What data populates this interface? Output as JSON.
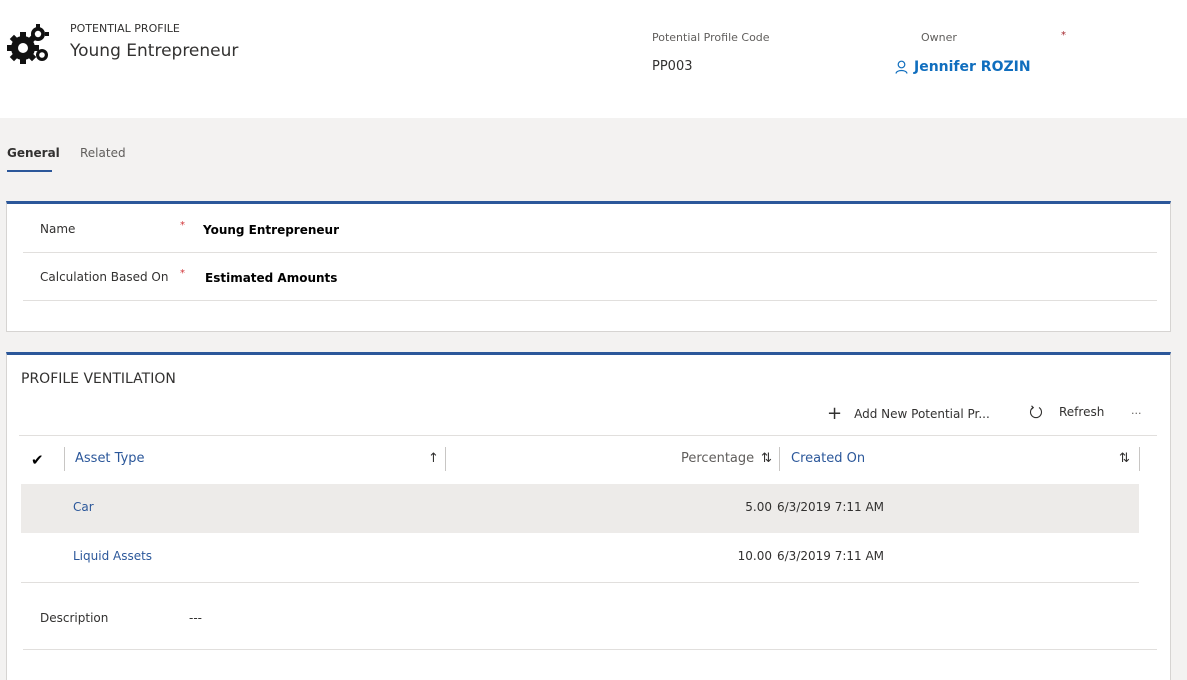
{
  "header": {
    "entity_type": "POTENTIAL PROFILE",
    "record_name": "Young Entrepreneur",
    "code_label": "Potential Profile Code",
    "code_value": "PP003",
    "owner_label": "Owner",
    "owner_required": "*",
    "owner_value": "Jennifer ROZIN",
    "logo_icon": "gears-icon",
    "owner_icon": "person-icon"
  },
  "tabs": [
    {
      "label": "General",
      "active": true
    },
    {
      "label": "Related",
      "active": false
    }
  ],
  "general": {
    "fields": [
      {
        "label": "Name",
        "required": "*",
        "value": "Young Entrepreneur"
      },
      {
        "label": "Calculation Based On",
        "required": "*",
        "value": "Estimated Amounts"
      }
    ]
  },
  "ventilation": {
    "title": "PROFILE VENTILATION",
    "commands": {
      "add_label": "Add New Potential Pr...",
      "refresh_label": "Refresh",
      "more_label": "···"
    },
    "columns": {
      "asset_type": "Asset Type",
      "percentage": "Percentage",
      "created_on": "Created On"
    },
    "rows": [
      {
        "asset_type": "Car",
        "percentage": "5.00",
        "created_on": "6/3/2019 7:11 AM"
      },
      {
        "asset_type": "Liquid Assets",
        "percentage": "10.00",
        "created_on": "6/3/2019 7:11 AM"
      }
    ],
    "description_label": "Description",
    "description_value": "---"
  },
  "colors": {
    "accent": "#2b579a",
    "link": "#106ebe",
    "required": "#d13438",
    "background": "#f3f2f1",
    "selected_row": "#edebe9"
  }
}
